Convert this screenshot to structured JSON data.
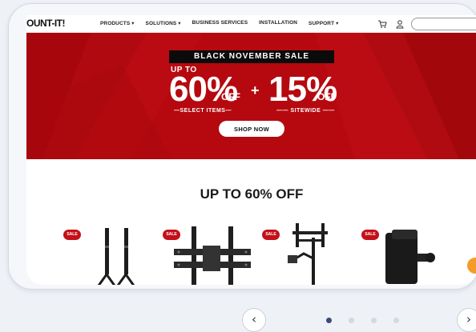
{
  "nav": {
    "logo": "OUNT-IT!",
    "menu": [
      "PRODUCTS ▾",
      "SOLUTIONS ▾",
      "BUSINESS SERVICES",
      "INSTALLATION",
      "SUPPORT ▾"
    ],
    "cart_icon": "cart-icon",
    "user_icon": "user-icon",
    "search_placeholder": ""
  },
  "hero": {
    "banner": "BLACK NOVEMBER SALE",
    "up_to": "UP TO",
    "left_percent": "60%",
    "left_off": "OFF",
    "plus": "+",
    "right_percent": "15%",
    "right_off": "OFF",
    "left_sub": "—SELECT ITEMS—",
    "right_sub": "—— SITEWIDE ——",
    "button": "SHOP NOW",
    "colors": {
      "background": "#b5090f",
      "banner": "#0b0b0b"
    }
  },
  "section": {
    "title": "UP TO 60% OFF",
    "products": [
      {
        "badge": "SALE",
        "name": "tv-stand-legs"
      },
      {
        "badge": "SALE",
        "name": "tilting-wall-mount"
      },
      {
        "badge": "SALE",
        "name": "pole-mount"
      },
      {
        "badge": "SALE",
        "name": "speaker-mount"
      }
    ]
  },
  "carousel": {
    "prev": "‹",
    "next": "›",
    "pages": 4,
    "active_page": 1
  }
}
